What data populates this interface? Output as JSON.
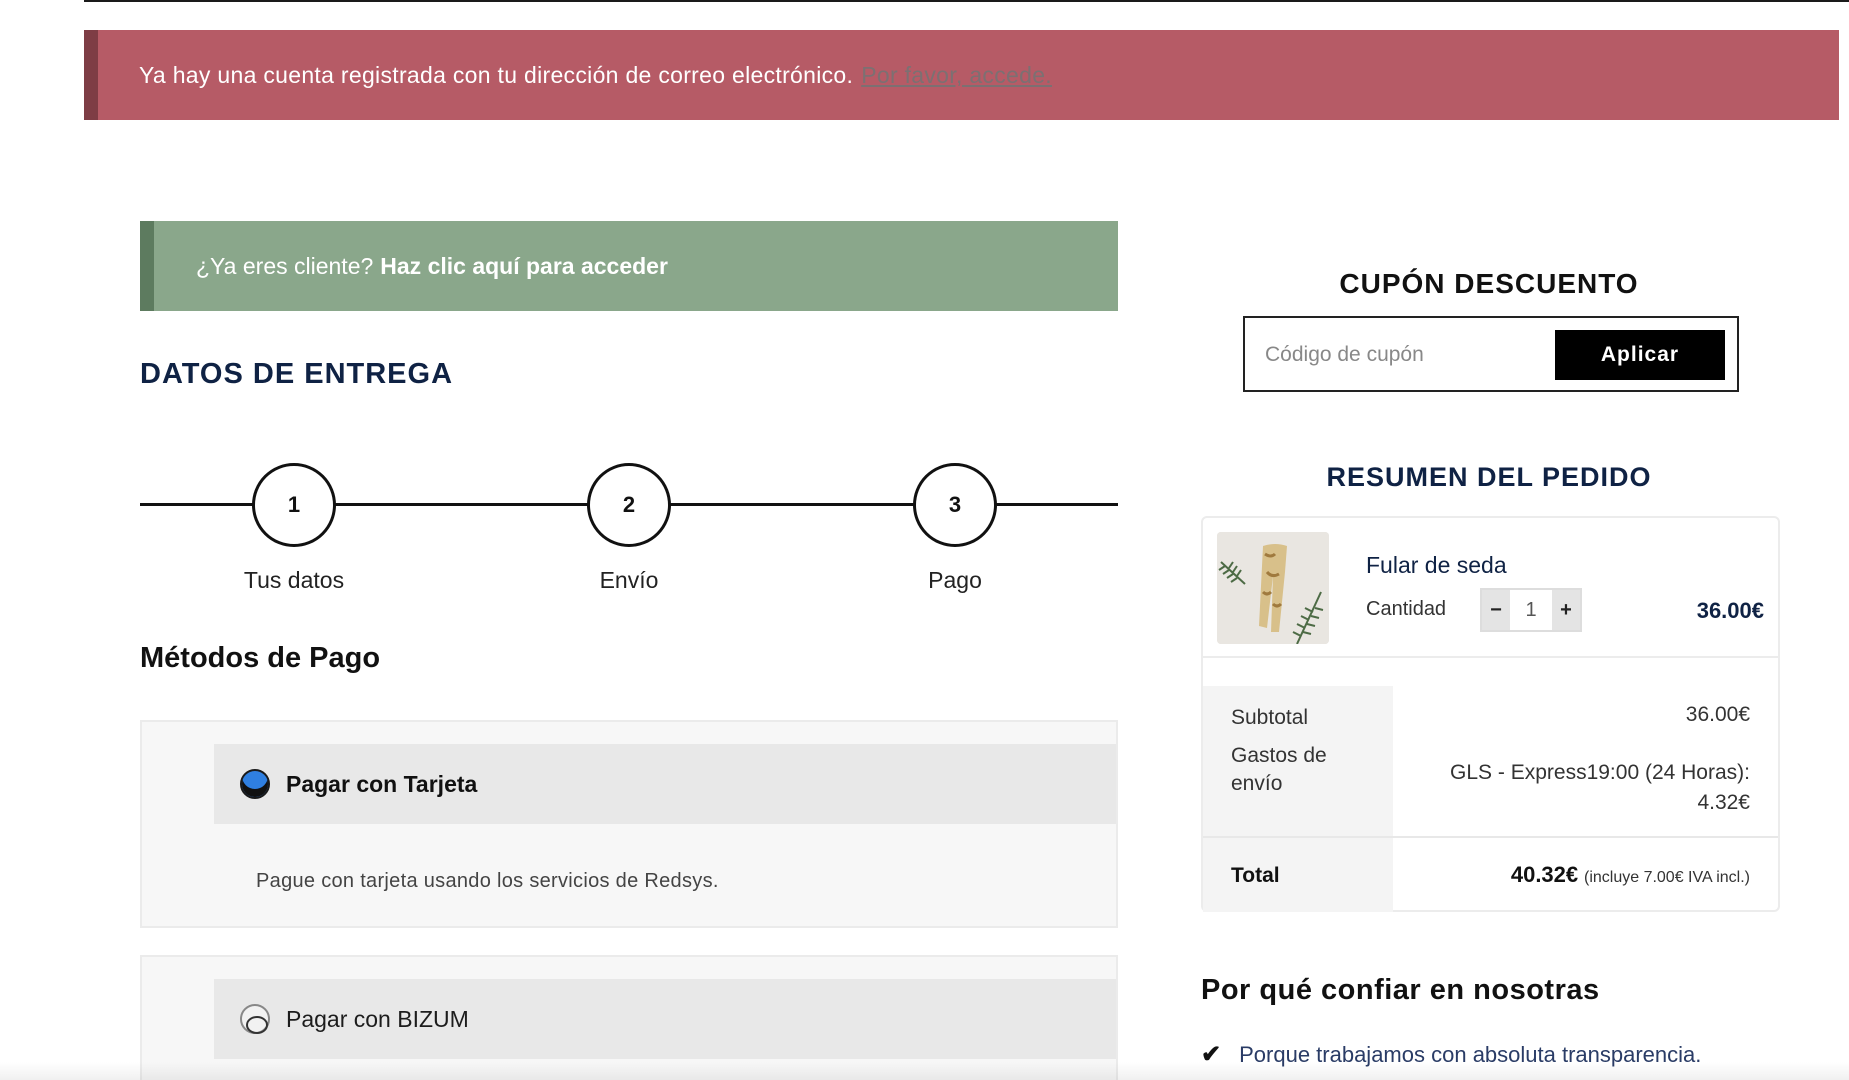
{
  "notices": {
    "error_text": "Ya hay una cuenta registrada con tu dirección de correo electrónico.",
    "error_link": "Por favor, accede.",
    "returning_prefix": "¿Ya eres cliente?",
    "returning_link": "Haz clic aquí para acceder"
  },
  "checkout": {
    "section_title": "DATOS DE ENTREGA",
    "steps": [
      {
        "number": "1",
        "label": "Tus datos"
      },
      {
        "number": "2",
        "label": "Envío"
      },
      {
        "number": "3",
        "label": "Pago"
      }
    ],
    "payment_title": "Métodos de Pago",
    "payment_methods": [
      {
        "label": "Pagar con Tarjeta",
        "selected": true,
        "description": "Pague con tarjeta usando los servicios de Redsys."
      },
      {
        "label": "Pagar con BIZUM",
        "selected": false
      }
    ]
  },
  "coupon": {
    "title": "CUPÓN DESCUENTO",
    "placeholder": "Código de cupón",
    "button": "Aplicar"
  },
  "summary": {
    "title": "RESUMEN DEL PEDIDO",
    "product": {
      "name": "Fular de seda",
      "quantity_label": "Cantidad",
      "quantity": "1",
      "price": "36.00€"
    },
    "subtotal_label": "Subtotal",
    "subtotal_value": "36.00€",
    "shipping_label": "Gastos de envío",
    "shipping_method": "GLS - Express19:00 (24 Horas):",
    "shipping_cost": "4.32€",
    "total_label": "Total",
    "total_value": "40.32€",
    "tax_note": "(incluye 7.00€ IVA incl.)"
  },
  "trust": {
    "title": "Por qué confiar en nosotras",
    "items": [
      "Porque trabajamos con absoluta transparencia."
    ]
  },
  "colors": {
    "error_bg": "#b65b66",
    "info_bg": "#8aa78b",
    "navy": "#0f2244",
    "radio_selected": "#2f7fe0"
  }
}
